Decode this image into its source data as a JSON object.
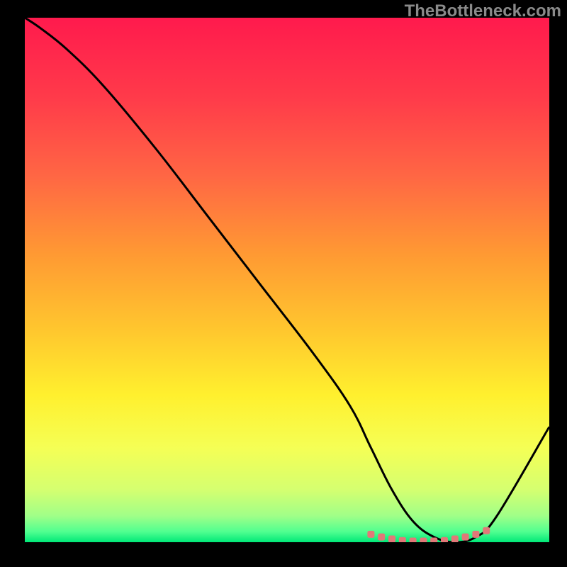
{
  "watermark": "TheBottleneck.com",
  "chart_data": {
    "type": "line",
    "title": "",
    "xlabel": "",
    "ylabel": "",
    "xlim": [
      0,
      100
    ],
    "ylim": [
      0,
      100
    ],
    "grid": false,
    "series": [
      {
        "name": "bottleneck-curve",
        "color": "#000000",
        "x": [
          0,
          3,
          8,
          15,
          25,
          35,
          45,
          55,
          62,
          66,
          70,
          74,
          78,
          82,
          86,
          90,
          100
        ],
        "y": [
          100,
          98,
          94,
          87,
          75,
          62,
          49,
          36,
          26,
          18,
          10,
          4,
          1,
          0,
          1,
          5,
          22
        ]
      }
    ],
    "markers": {
      "name": "optimal-range",
      "color": "#e27878",
      "x": [
        66,
        68,
        70,
        72,
        74,
        76,
        78,
        80,
        82,
        84,
        86,
        88
      ],
      "y": [
        1.5,
        1.0,
        0.6,
        0.3,
        0.2,
        0.2,
        0.2,
        0.3,
        0.6,
        1.0,
        1.5,
        2.2
      ]
    },
    "background_gradient": {
      "type": "vertical",
      "stops": [
        {
          "offset": 0.0,
          "color": "#ff1a4d"
        },
        {
          "offset": 0.15,
          "color": "#ff3a4a"
        },
        {
          "offset": 0.3,
          "color": "#ff6644"
        },
        {
          "offset": 0.45,
          "color": "#ff9933"
        },
        {
          "offset": 0.6,
          "color": "#ffc82e"
        },
        {
          "offset": 0.72,
          "color": "#fff02e"
        },
        {
          "offset": 0.82,
          "color": "#f5ff55"
        },
        {
          "offset": 0.9,
          "color": "#d5ff70"
        },
        {
          "offset": 0.95,
          "color": "#a0ff88"
        },
        {
          "offset": 0.98,
          "color": "#50ff90"
        },
        {
          "offset": 1.0,
          "color": "#00e878"
        }
      ]
    }
  }
}
